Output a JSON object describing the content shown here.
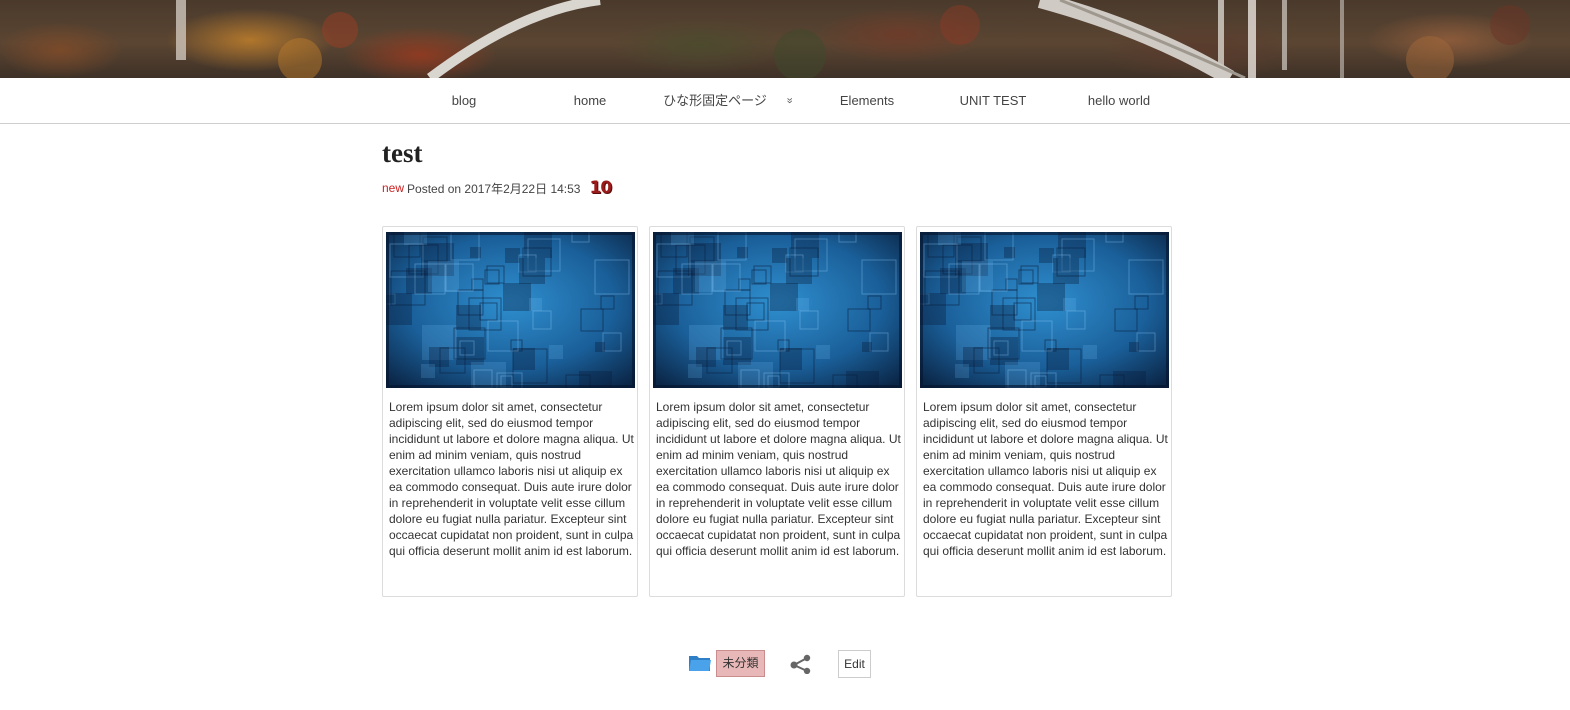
{
  "nav": {
    "items": [
      {
        "label": "blog"
      },
      {
        "label": "home"
      },
      {
        "label": "ひな形固定ページ",
        "has_dropdown": true
      },
      {
        "label": "Elements"
      },
      {
        "label": "UNIT TEST"
      },
      {
        "label": "hello world"
      }
    ],
    "dropdown_caret": "»"
  },
  "post": {
    "title": "test",
    "new_label": "new",
    "posted_text": "Posted on 2017年2月22日 14:53",
    "comment_count": "10"
  },
  "cards": [
    {
      "image": "blue-squares-pattern",
      "text": "Lorem ipsum dolor sit amet, consectetur adipiscing elit, sed do eiusmod tempor incididunt ut labore et dolore magna aliqua. Ut enim ad minim veniam, quis nostrud exercitation ullamco laboris nisi ut aliquip ex ea commodo consequat. Duis aute irure dolor in reprehenderit in voluptate velit esse cillum dolore eu fugiat nulla pariatur. Excepteur sint occaecat cupidatat non proident, sunt in culpa qui officia deserunt mollit anim id est laborum."
    },
    {
      "image": "blue-squares-pattern",
      "text": "Lorem ipsum dolor sit amet, consectetur adipiscing elit, sed do eiusmod tempor incididunt ut labore et dolore magna aliqua. Ut enim ad minim veniam, quis nostrud exercitation ullamco laboris nisi ut aliquip ex ea commodo consequat. Duis aute irure dolor in reprehenderit in voluptate velit esse cillum dolore eu fugiat nulla pariatur. Excepteur sint occaecat cupidatat non proident, sunt in culpa qui officia deserunt mollit anim id est laborum."
    },
    {
      "image": "blue-squares-pattern",
      "text": "Lorem ipsum dolor sit amet, consectetur adipiscing elit, sed do eiusmod tempor incididunt ut labore et dolore magna aliqua. Ut enim ad minim veniam, quis nostrud exercitation ullamco laboris nisi ut aliquip ex ea commodo consequat. Duis aute irure dolor in reprehenderit in voluptate velit esse cillum dolore eu fugiat nulla pariatur. Excepteur sint occaecat cupidatat non proident, sunt in culpa qui officia deserunt mollit anim id est laborum."
    }
  ],
  "footer": {
    "category_icon": "folder-icon",
    "category_label": "未分類",
    "share_icon": "share-icon",
    "edit_label": "Edit"
  },
  "colors": {
    "new_label": "#cc1f1f",
    "comment_badge": "#9b1a1a",
    "category_bg": "#e8b7b7",
    "folder_icon": "#3b8fd8"
  }
}
